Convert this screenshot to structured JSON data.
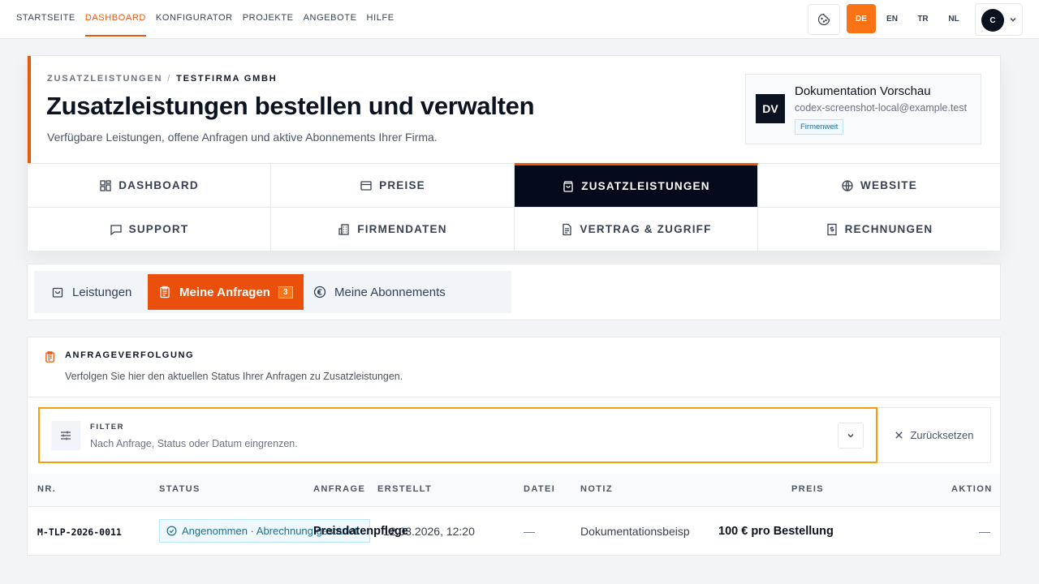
{
  "nav": {
    "links": [
      "STARTSEITE",
      "DASHBOARD",
      "KONFIGURATOR",
      "PROJEKTE",
      "ANGEBOTE",
      "HILFE"
    ],
    "active_index": 1,
    "languages": [
      "DE",
      "EN",
      "TR",
      "NL"
    ],
    "active_language": "DE",
    "avatar_initial": "C"
  },
  "header": {
    "breadcrumb": [
      "ZUSATZLEISTUNGEN",
      "TESTFIRMA GMBH"
    ],
    "breadcrumb_sep": "/",
    "title": "Zusatzleistungen bestellen und verwalten",
    "subtitle": "Verfügbare Leistungen, offene Anfragen und aktive Abonnements Ihrer Firma.",
    "user": {
      "logo": "DV",
      "name": "Dokumentation Vorschau",
      "email": "codex-screenshot-local@example.test",
      "badge": "Firmenweit"
    }
  },
  "tabs": [
    {
      "label": "DASHBOARD",
      "icon": "grid-icon"
    },
    {
      "label": "PREISE",
      "icon": "card-icon"
    },
    {
      "label": "ZUSATZLEISTUNGEN",
      "icon": "bag-icon",
      "active": true
    },
    {
      "label": "WEBSITE",
      "icon": "globe-icon"
    },
    {
      "label": "SUPPORT",
      "icon": "chat-icon"
    },
    {
      "label": "FIRMENDATEN",
      "icon": "building-icon"
    },
    {
      "label": "VERTRAG & ZUGRIFF",
      "icon": "document-icon"
    },
    {
      "label": "RECHNUNGEN",
      "icon": "invoice-icon"
    }
  ],
  "subtabs": {
    "leistungen": "Leistungen",
    "anfragen": "Meine Anfragen",
    "anfragen_count": "3",
    "abonnements": "Meine Abonnements"
  },
  "tracking": {
    "title": "ANFRAGEVERFOLGUNG",
    "description": "Verfolgen Sie hier den aktuellen Status Ihrer Anfragen zu Zusatzleistungen.",
    "filter_label": "FILTER",
    "filter_desc": "Nach Anfrage, Status oder Datum eingrenzen.",
    "reset_label": "Zurücksetzen",
    "columns": {
      "nr": "NR.",
      "status": "STATUS",
      "anfrage": "ANFRAGE",
      "erstellt": "ERSTELLT",
      "datei": "DATEI",
      "notiz": "NOTIZ",
      "preis": "PREIS",
      "aktion": "AKTION"
    },
    "rows": [
      {
        "nr": "M-TLP-2026-0011",
        "status": "Angenommen · Abrechnung gestartet",
        "anfrage": "Preisdatenpflege",
        "erstellt": "12.03.2026, 12:20",
        "datei": "—",
        "notiz": "Dokumentationsbeisp",
        "preis": "100 € pro Bestellung",
        "aktion": "—"
      }
    ]
  },
  "colors": {
    "accent": "#ea580c",
    "dark": "#050a1a",
    "status_text": "#1d6f8e"
  }
}
